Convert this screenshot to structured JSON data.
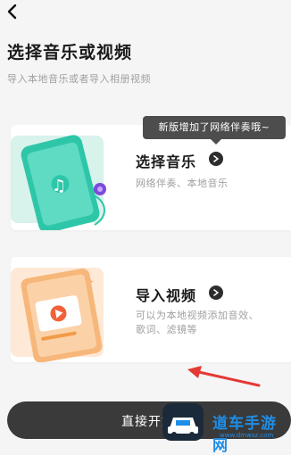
{
  "page": {
    "title": "选择音乐或视频",
    "subtitle": "导入本地音乐或者导入相册视频"
  },
  "tooltip": {
    "text": "新版增加了网络伴奏哦~"
  },
  "cards": [
    {
      "title": "选择音乐",
      "description": "网络伴奏、本地音乐"
    },
    {
      "title": "导入视频",
      "description": "可以为本地视频添加音效、歌词、滤镜等"
    }
  ],
  "bottom": {
    "label": "直接开始"
  },
  "watermark": {
    "text": "道车手游网",
    "url": "www.dmwsz.com"
  },
  "colors": {
    "accent_teal": "#2ec6a8",
    "accent_orange": "#f29a48",
    "watermark_blue": "#1f8ee8",
    "arrow_red": "#e53935"
  }
}
